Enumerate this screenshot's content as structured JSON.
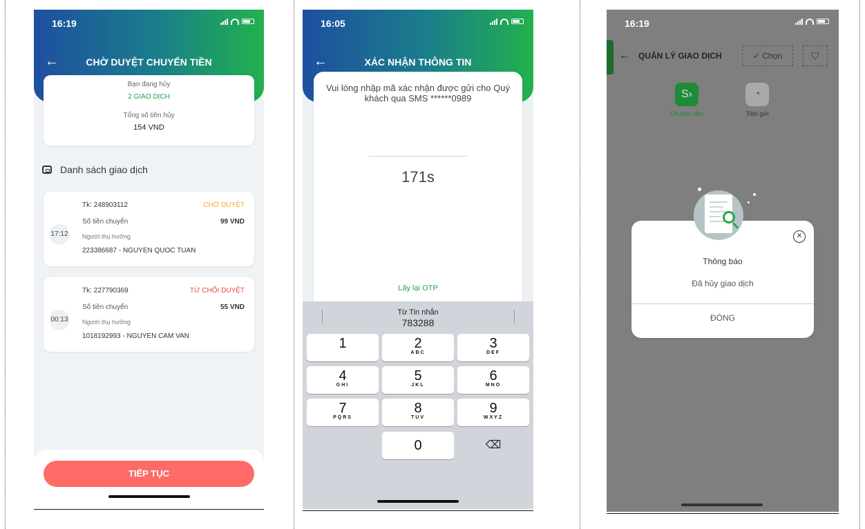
{
  "screen1": {
    "status_time": "16:19",
    "title": "CHỜ DUYỆT CHUYỂN TIỀN",
    "summary": {
      "cancel_label": "Bạn đang hủy",
      "cancel_value": "2 GIAO DỊCH",
      "total_label": "Tổng số tiền hủy",
      "total_value": "154 VND"
    },
    "list_title": "Danh sách giao dịch",
    "transactions": [
      {
        "time": "17:12",
        "account": "Tk: 248903112",
        "status": "CHỜ DUYỆT",
        "status_color": "#f5a623",
        "amount_label": "Số tiền chuyển",
        "amount": "99 VND",
        "beneficiary_label": "Người thụ hưởng",
        "beneficiary": "223386687 - NGUYEN QUOC TUAN"
      },
      {
        "time": "00:13",
        "account": "Tk: 227790369",
        "status": "TỪ CHỐI DUYỆT",
        "status_color": "#ef4444",
        "amount_label": "Số tiền chuyển",
        "amount": "55 VND",
        "beneficiary_label": "Người thụ hưởng",
        "beneficiary": "1018192993 - NGUYEN CAM VAN"
      }
    ],
    "continue_button": "TIẾP TỤC"
  },
  "screen2": {
    "status_time": "16:05",
    "title": "XÁC NHẬN THÔNG TIN",
    "message": "Vui lòng nhập mã xác nhận được gửi cho Quý khách qua SMS ******0989",
    "countdown": "171s",
    "resend": "Lấy lại OTP",
    "suggestion_source": "Từ Tin nhắn",
    "suggestion_code": "783288",
    "keys": [
      {
        "num": "1",
        "letters": ""
      },
      {
        "num": "2",
        "letters": "ABC"
      },
      {
        "num": "3",
        "letters": "DEF"
      },
      {
        "num": "4",
        "letters": "GHI"
      },
      {
        "num": "5",
        "letters": "JKL"
      },
      {
        "num": "6",
        "letters": "MNO"
      },
      {
        "num": "7",
        "letters": "PQRS"
      },
      {
        "num": "8",
        "letters": "TUV"
      },
      {
        "num": "9",
        "letters": "WXYZ"
      },
      {
        "num": "0",
        "letters": ""
      }
    ],
    "delete_icon": "backspace-icon"
  },
  "screen3": {
    "status_time": "16:19",
    "title": "QUẢN LÝ GIAO DỊCH",
    "select_button": "Chọn",
    "services": [
      {
        "label": "Chuyển tiền",
        "icon": "money-transfer-icon"
      },
      {
        "label": "Tiền gửi",
        "icon": "piggy-bank-icon"
      }
    ],
    "dialog": {
      "title": "Thông báo",
      "message": "Đã hủy giao dịch",
      "button": "ĐÓNG"
    }
  },
  "colors": {
    "header_gradient_start": "#1e4fa1",
    "header_gradient_end": "#22b24c",
    "accent_green": "#22a24a",
    "cta_red": "#ff6b66",
    "pending_orange": "#f5a623",
    "rejected_red": "#ef4444"
  }
}
